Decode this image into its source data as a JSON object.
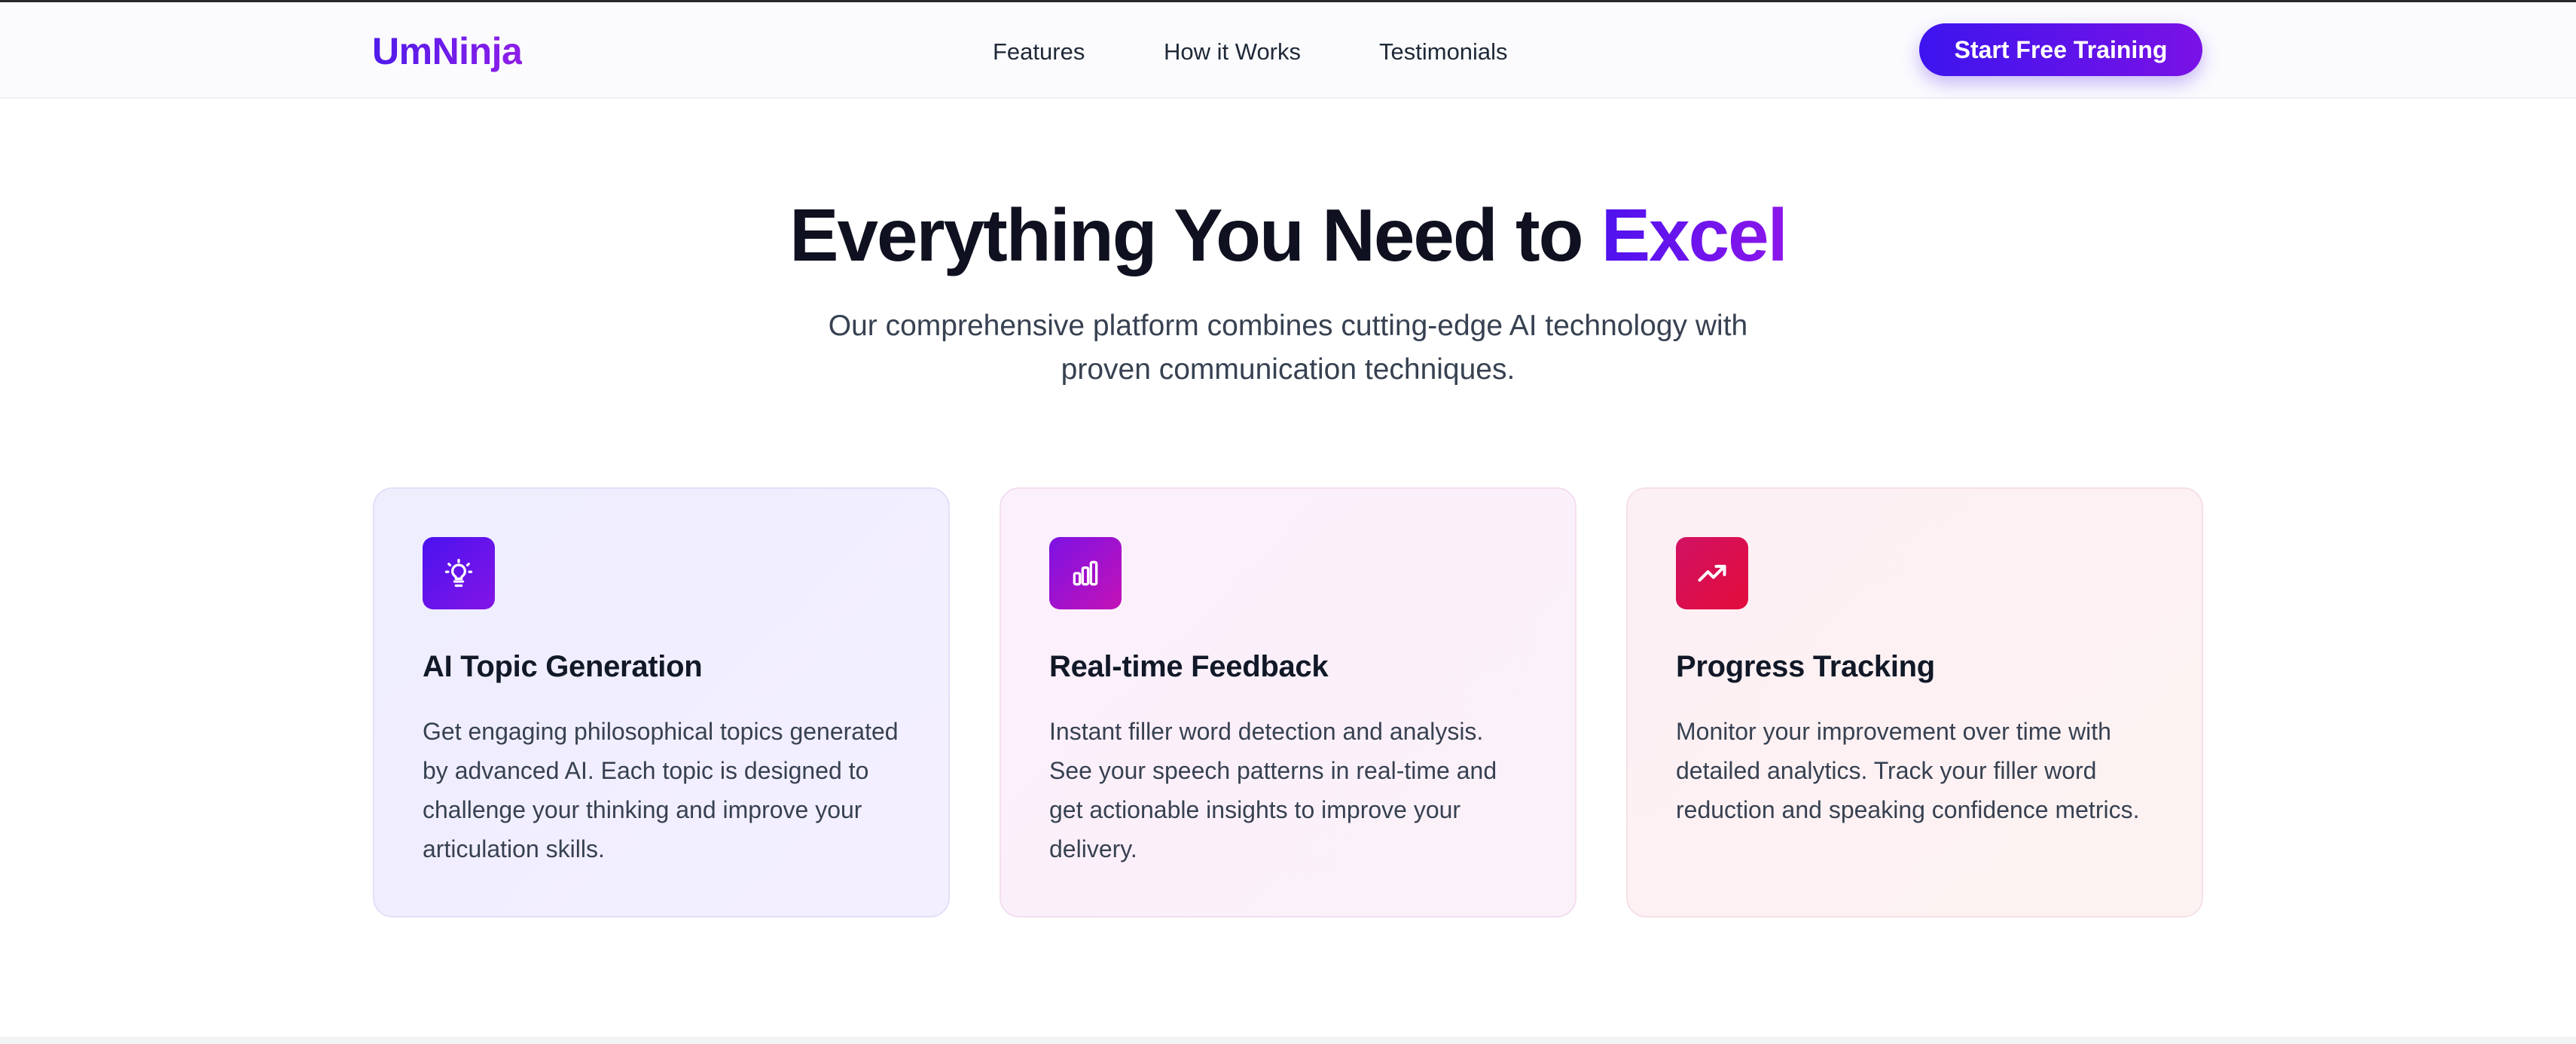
{
  "nav": {
    "brand": "UmNinja",
    "links": [
      "Features",
      "How it Works",
      "Testimonials"
    ],
    "cta_label": "Start Free Training"
  },
  "hero": {
    "title_main": "Everything You Need to ",
    "title_accent": "Excel",
    "subtitle": "Our comprehensive platform combines cutting-edge AI technology with proven communication techniques."
  },
  "features": [
    {
      "icon": "lightbulb-icon",
      "title": "AI Topic Generation",
      "body": "Get engaging philosophical topics generated by advanced AI. Each topic is designed to challenge your thinking and improve your articulation skills."
    },
    {
      "icon": "bar-chart-icon",
      "title": "Real-time Feedback",
      "body": "Instant filler word detection and analysis. See your speech patterns in real-time and get actionable insights to improve your delivery."
    },
    {
      "icon": "trending-up-icon",
      "title": "Progress Tracking",
      "body": "Monitor your improvement over time with detailed analytics. Track your filler word reduction and speaking confidence metrics."
    }
  ],
  "colors": {
    "brand_start": "#4f1bea",
    "brand_end": "#8e1ee8",
    "feature1_icon": "#5a13ec",
    "feature2_icon": "#a312d0",
    "feature3_icon": "#dc0f4c"
  }
}
